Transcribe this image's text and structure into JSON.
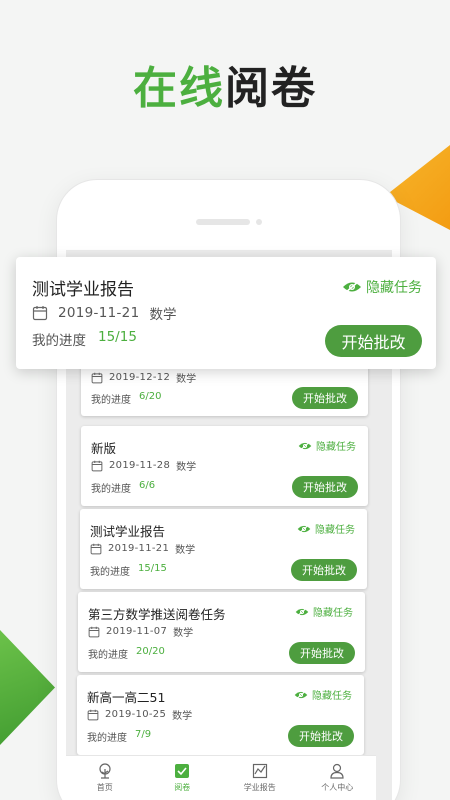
{
  "headline": {
    "part1": "在线",
    "part2": "阅卷"
  },
  "colors": {
    "accent": "#4caf3f",
    "button": "#4e9d3f",
    "orange": "#f39c12"
  },
  "featured": {
    "title": "测试学业报告",
    "hide_label": "隐藏任务",
    "date": "2019-11-21",
    "subject": "数学",
    "progress_label": "我的进度",
    "progress_value": "15/15",
    "button_label": "开始批改"
  },
  "tasks": [
    {
      "title": "",
      "hide_label": "",
      "date": "2019-12-12",
      "subject": "数学",
      "progress_label": "我的进度",
      "progress_value": "6/20",
      "button_label": "开始批改"
    },
    {
      "title": "新版",
      "hide_label": "隐藏任务",
      "date": "2019-11-28",
      "subject": "数学",
      "progress_label": "我的进度",
      "progress_value": "6/6",
      "button_label": "开始批改"
    },
    {
      "title": "测试学业报告",
      "hide_label": "隐藏任务",
      "date": "2019-11-21",
      "subject": "数学",
      "progress_label": "我的进度",
      "progress_value": "15/15",
      "button_label": "开始批改"
    },
    {
      "title": "第三方数学推送阅卷任务",
      "hide_label": "隐藏任务",
      "date": "2019-11-07",
      "subject": "数学",
      "progress_label": "我的进度",
      "progress_value": "20/20",
      "button_label": "开始批改"
    },
    {
      "title": "新高一高二51",
      "hide_label": "隐藏任务",
      "date": "2019-10-25",
      "subject": "数学",
      "progress_label": "我的进度",
      "progress_value": "7/9",
      "button_label": "开始批改"
    }
  ],
  "tabbar": [
    {
      "label": "首页",
      "icon": "tree-icon",
      "active": false
    },
    {
      "label": "阅卷",
      "icon": "check-icon",
      "active": true
    },
    {
      "label": "学业报告",
      "icon": "chart-icon",
      "active": false
    },
    {
      "label": "个人中心",
      "icon": "person-icon",
      "active": false
    }
  ]
}
